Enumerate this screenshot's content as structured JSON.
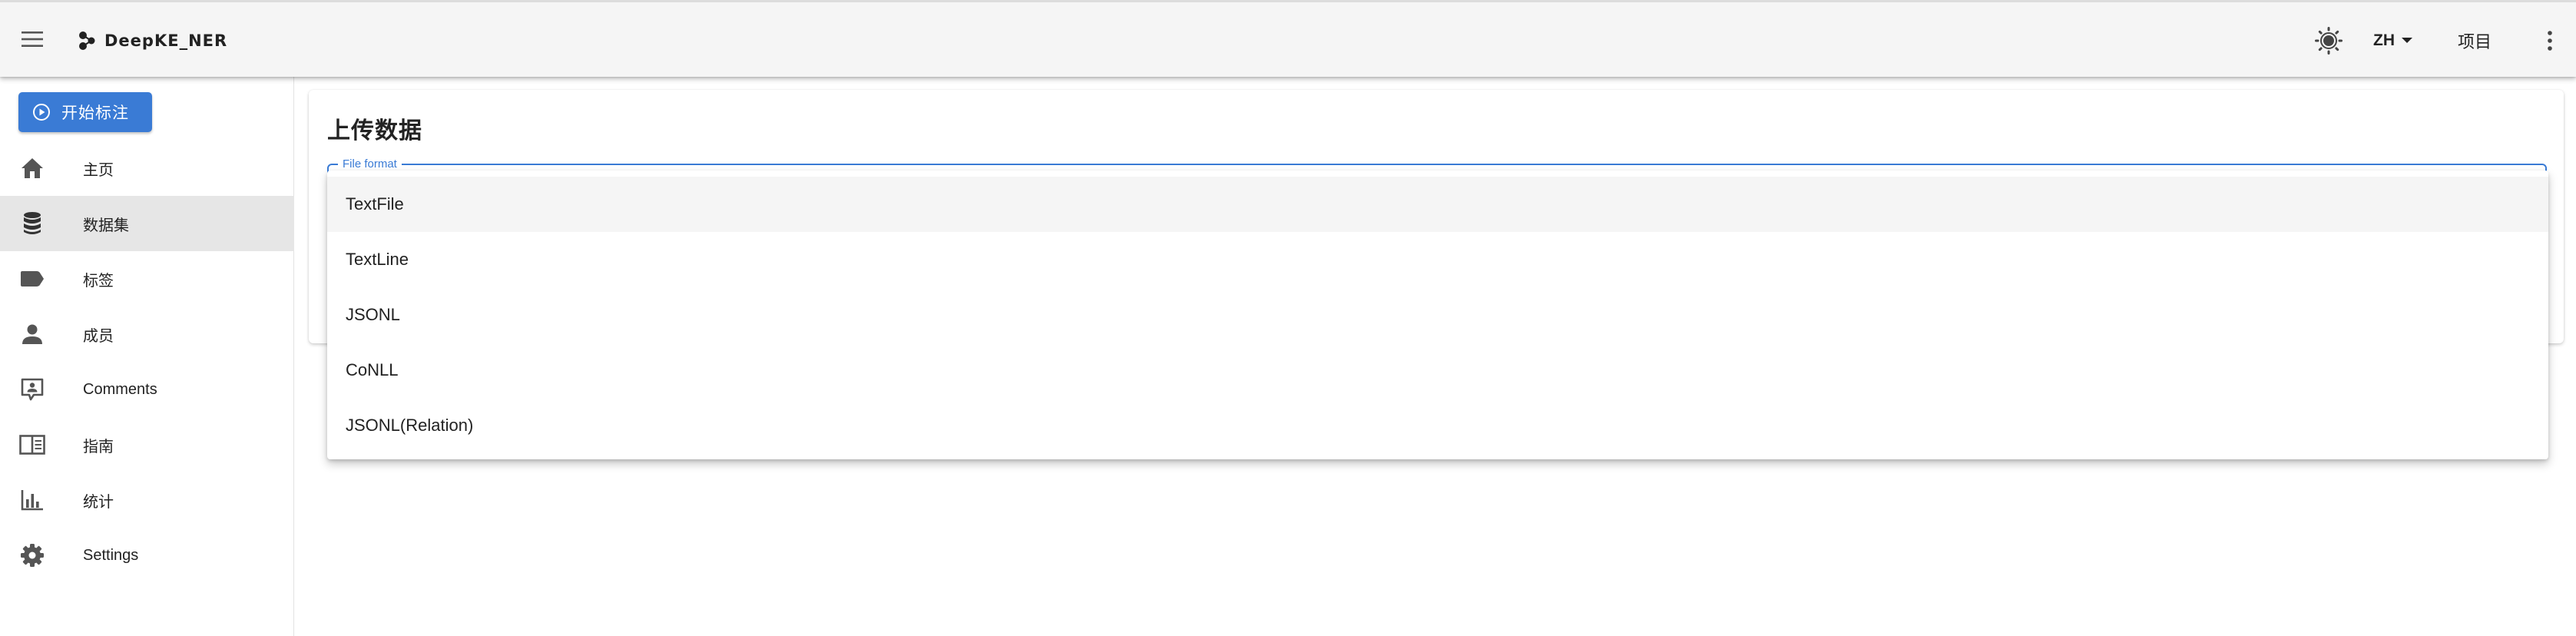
{
  "appbar": {
    "title": "DeepKE_NER",
    "language": "ZH",
    "projects_label": "项目",
    "icons": {
      "menu": "hamburger-menu-icon",
      "logo": "molecule-icon",
      "theme": "brightness-icon",
      "language_caret": "caret-down-icon",
      "more": "dots-vertical-icon"
    }
  },
  "sidebar": {
    "start_label": "开始标注",
    "items": [
      {
        "label": "主页",
        "icon": "home-icon"
      },
      {
        "label": "数据集",
        "icon": "database-icon",
        "active": true
      },
      {
        "label": "标签",
        "icon": "label-icon"
      },
      {
        "label": "成员",
        "icon": "account-icon"
      },
      {
        "label": "Comments",
        "icon": "comment-account-icon"
      },
      {
        "label": "指南",
        "icon": "book-open-icon"
      },
      {
        "label": "统计",
        "icon": "chart-bar-icon"
      },
      {
        "label": "Settings",
        "icon": "cog-icon"
      }
    ]
  },
  "main": {
    "title": "上传数据",
    "file_format_label": "File format"
  },
  "dropdown": {
    "options": [
      "TextFile",
      "TextLine",
      "JSONL",
      "CoNLL",
      "JSONL(Relation)"
    ],
    "highlighted_index": 0
  },
  "colors": {
    "primary": "#3a7bd5",
    "appbar": "#f5f5f5",
    "active_nav": "#e6e6e6",
    "icon": "#555555"
  }
}
